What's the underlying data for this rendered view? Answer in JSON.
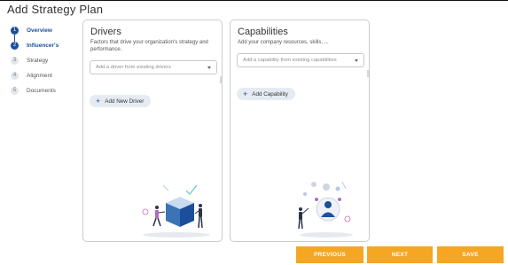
{
  "page": {
    "title": "Add Strategy Plan"
  },
  "stepper": {
    "steps": [
      {
        "number": "1",
        "label": "Overview"
      },
      {
        "number": "2",
        "label": "Influencer's"
      },
      {
        "number": "3",
        "label": "Strategy"
      },
      {
        "number": "4",
        "label": "Alignment"
      },
      {
        "number": "5",
        "label": "Documents"
      }
    ]
  },
  "drivers": {
    "title": "Drivers",
    "description": "Factors that drive your organization's strategy and performance.",
    "select_placeholder": "Add a driver from existing drivers",
    "add_label": "Add New Driver"
  },
  "capabilities": {
    "title": "Capabilities",
    "description": "Add your company resources, skills, ...",
    "select_placeholder": "Add a capability from existing capabilities",
    "add_label": "Add Capability"
  },
  "footer": {
    "previous_label": "PREVIOUS",
    "next_label": "NEXT",
    "save_label": "SAVE"
  },
  "colors": {
    "accent": "#1b4f9c",
    "button": "#f5a623"
  }
}
